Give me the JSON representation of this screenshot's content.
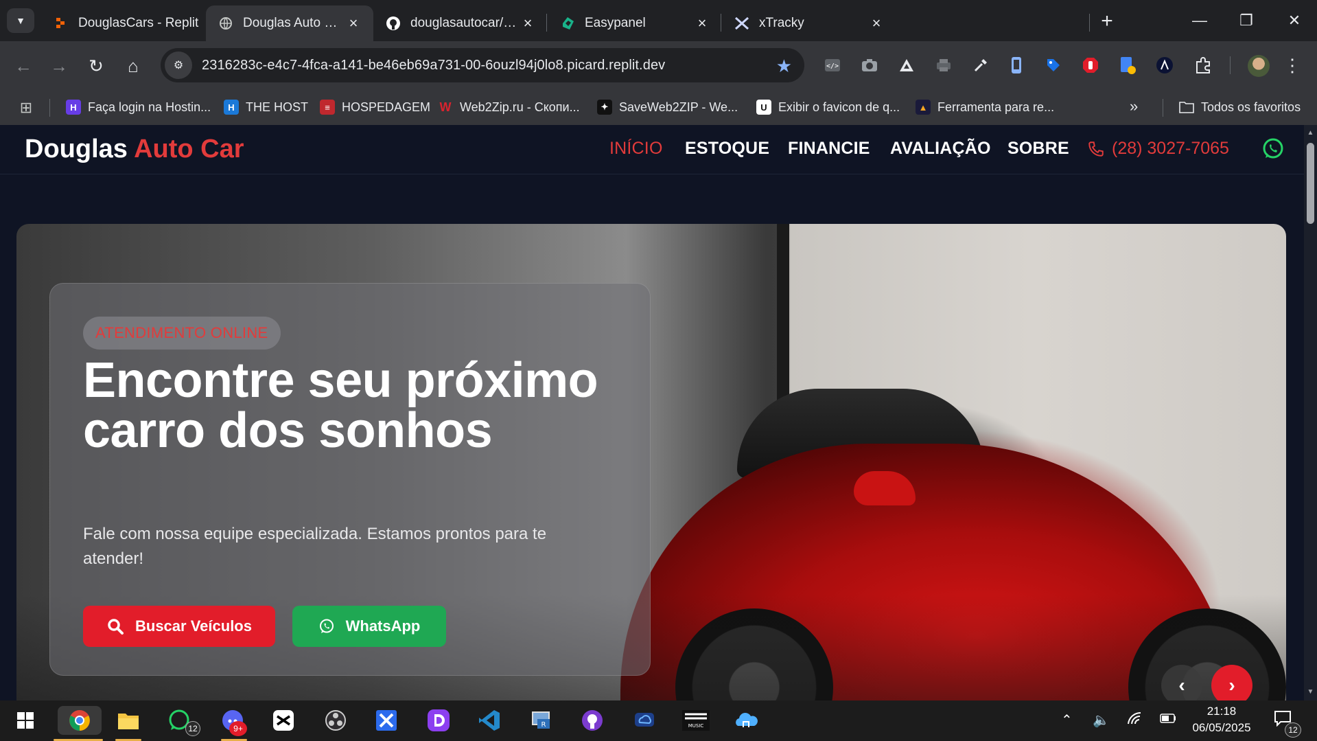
{
  "browser": {
    "tabs": [
      {
        "title": "DouglasCars - Replit",
        "active": false
      },
      {
        "title": "Douglas Auto Car | Seu P",
        "active": true
      },
      {
        "title": "douglasautocar/Dockerfil",
        "active": false
      },
      {
        "title": "Easypanel",
        "active": false
      },
      {
        "title": "xTracky",
        "active": false
      }
    ],
    "url": "2316283c-e4c7-4fca-a141-be46eb69a731-00-6ouzl94j0lo8.picard.replit.dev",
    "bookmarks": [
      {
        "label": "Faça login na Hostin...",
        "color": "#673de6",
        "glyph": "H"
      },
      {
        "label": "THE HOST",
        "color": "#1b79d8",
        "glyph": "H"
      },
      {
        "label": "HOSPEDAGEM",
        "color": "#c0282e",
        "glyph": "≡"
      },
      {
        "label": "Web2Zip.ru - Скопи...",
        "color": "#d9232e",
        "glyph": "W"
      },
      {
        "label": "SaveWeb2ZIP - We...",
        "color": "#111111",
        "glyph": "✦"
      },
      {
        "label": "Exibir o favicon de q...",
        "color": "#ffffff",
        "glyph": "U"
      },
      {
        "label": "Ferramenta para re...",
        "color": "#1a1a3a",
        "glyph": "▲"
      }
    ],
    "all_bookmarks": "Todos os favoritos"
  },
  "site": {
    "logo_main": "Douglas",
    "logo_accent": "Auto Car",
    "nav": [
      "INÍCIO",
      "ESTOQUE",
      "FINANCIE",
      "AVALIAÇÃO",
      "SOBRE"
    ],
    "phone": "(28) 3027-7065",
    "colors": {
      "accent": "#e23b3b",
      "background": "#0f1424",
      "whatsapp": "#1fa853"
    }
  },
  "hero": {
    "badge": "ATENDIMENTO ONLINE",
    "title": "Encontre seu próximo carro dos sonhos",
    "subtitle": "Fale com nossa equipe especializada. Estamos prontos para te atender!",
    "buttons": {
      "search": "Buscar Veículos",
      "whatsapp": "WhatsApp"
    }
  },
  "taskbar": {
    "whatsapp_badge": "12",
    "discord_badge": "9+",
    "time": "21:18",
    "date": "06/05/2025",
    "notifications": "12"
  }
}
